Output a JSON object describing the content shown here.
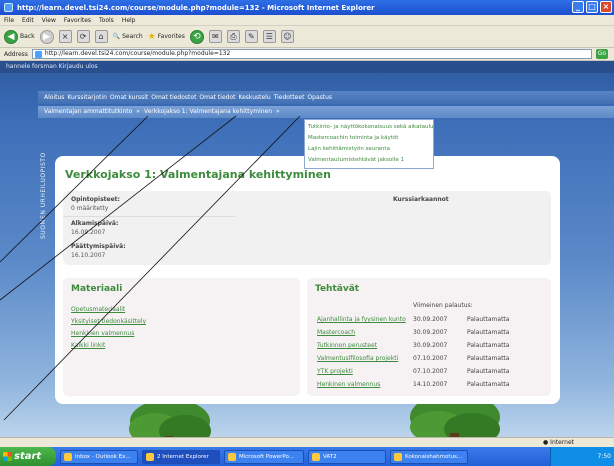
{
  "window": {
    "title": "http://learn.devel.tsi24.com/course/module.php?module=132 - Microsoft Internet Explorer"
  },
  "menu": [
    "File",
    "Edit",
    "View",
    "Favorites",
    "Tools",
    "Help"
  ],
  "toolbar": {
    "back": "Back",
    "search": "Search",
    "favorites": "Favorites"
  },
  "address": {
    "label": "Address",
    "value": "http://learn.devel.tsi24.com/course/module.php?module=132",
    "go": "Go"
  },
  "user_bar": "hannele forsman Kirjaudu ulos",
  "main_nav": [
    "Aloitus",
    "Kurssitarjotin",
    "Omat kurssit",
    "Omat tiedostot",
    "Omat tiedot",
    "Keskustelu",
    "Tiedotteet",
    "Opastus"
  ],
  "breadcrumb": [
    "Valmentajan ammattitutkinto",
    "»",
    "Verkkojakso 1: Valmentajana kehittyminen",
    "»"
  ],
  "sidebar_vertical": "SUOMEN URHEILUOPISTO",
  "dropdown_items": [
    "Tutkinto- ja näyttökokonaisuus sekä aikataulu",
    "Mastercoachin toiminta ja käytöt",
    "Lajin kehittämistyön seuranta",
    "Valmentautumistehtävät jaksolle 1"
  ],
  "page_title": "Verkkojakso 1: Valmentajana kehittyminen",
  "info": {
    "credits_label": "Opintopisteet:",
    "credits_value": "0 määritetty",
    "start_label": "Alkamispäivä:",
    "start_value": "16.09.2007",
    "end_label": "Päättymispäivä:",
    "end_value": "16.10.2007",
    "trainers_label": "Kurssiarkaannot"
  },
  "materials": {
    "title": "Materiaali",
    "links": [
      "Opetusmateriaalit",
      "Yksityiset tiedonkäsittely",
      "Henkinen valmennus",
      "Kaikki linkit"
    ]
  },
  "tasks": {
    "title": "Tehtävät",
    "deadline_header": "Viimeinen palautus:",
    "rows": [
      {
        "name": "Ajanhallinta ja fyysinen kunto",
        "date": "30.09.2007",
        "status": "Palauttamatta"
      },
      {
        "name": "Mastercoach",
        "date": "30.09.2007",
        "status": "Palauttamatta"
      },
      {
        "name": "Tutkinnon perusteet",
        "date": "30.09.2007",
        "status": "Palauttamatta"
      },
      {
        "name": "Valmentuslfilosofia projekti",
        "date": "07.10.2007",
        "status": "Palauttamatta"
      },
      {
        "name": "YTK projekti",
        "date": "07.10.2007",
        "status": "Palauttamatta"
      },
      {
        "name": "Henkinen valmennus",
        "date": "14.10.2007",
        "status": "Palauttamatta"
      }
    ]
  },
  "status_bar": {
    "zone": "Internet"
  },
  "taskbar": {
    "start": "start",
    "buttons": [
      "Inbox - Outlook Ex...",
      "2 Internet Explorer",
      "Microsoft PowerPo...",
      "VAT2",
      "Kokonaishahmotus..."
    ],
    "clock": "7:50"
  },
  "colors": {
    "accent_green": "#3d8b3d",
    "nav_blue": "#406fb3"
  }
}
